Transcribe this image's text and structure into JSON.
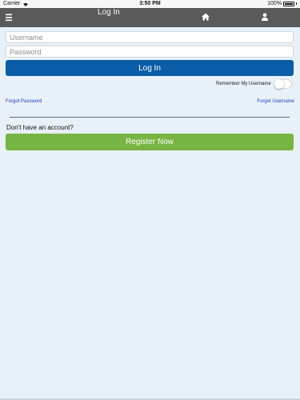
{
  "status_bar": {
    "carrier": "Carrier",
    "time": "3:50 PM",
    "battery": "100%"
  },
  "nav": {
    "title": "Log In",
    "menu_icon": "hamburger-menu-icon",
    "home_icon": "home-icon",
    "user_icon": "user-icon"
  },
  "form": {
    "username_placeholder": "Username",
    "password_placeholder": "Password",
    "login_label": "Log In",
    "remember_label": "Remember My Username",
    "remember_enabled": false,
    "forgot_password": "Forgot Password",
    "forgot_username": "Forgot Username"
  },
  "register": {
    "prompt": "Don't have an account?",
    "button_label": "Register Now"
  },
  "colors": {
    "background": "#e7f1f7",
    "nav_bar": "#5a5a5a",
    "login_button": "#0a5da6",
    "register_button": "#78b444",
    "link": "#1d3fb8"
  }
}
